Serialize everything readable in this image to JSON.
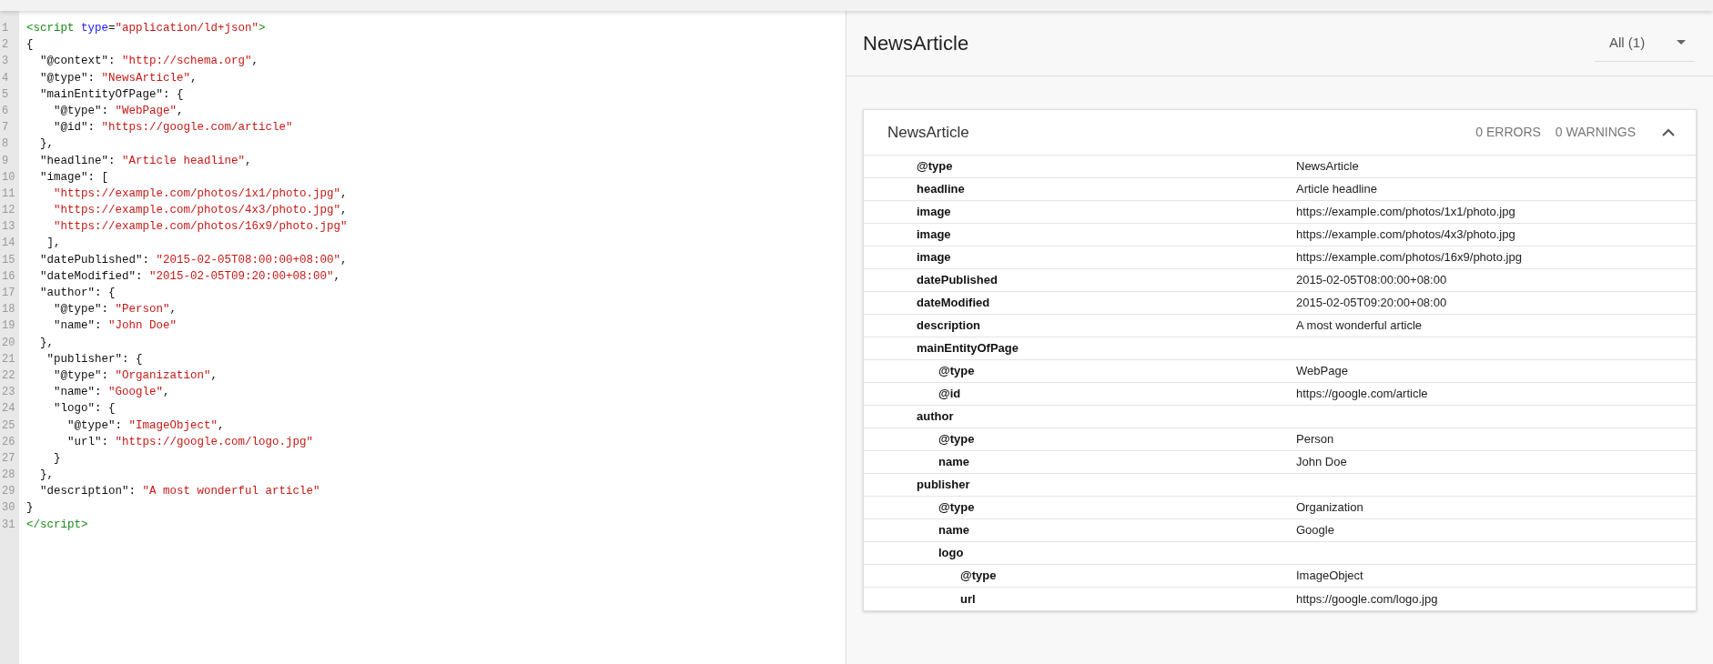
{
  "code": {
    "lines": [
      {
        "number": "1",
        "tokens": [
          {
            "kind": "tag",
            "text": "<script"
          },
          {
            "kind": "attr",
            "text": " type"
          },
          {
            "kind": "plain",
            "text": "="
          },
          {
            "kind": "string",
            "text": "\"application/ld+json\""
          },
          {
            "kind": "tag",
            "text": ">"
          }
        ]
      },
      {
        "number": "2",
        "tokens": [
          {
            "kind": "plain",
            "text": "{"
          }
        ]
      },
      {
        "number": "3",
        "tokens": [
          {
            "kind": "plain",
            "text": "  \"@context\": "
          },
          {
            "kind": "string",
            "text": "\"http://schema.org\""
          },
          {
            "kind": "plain",
            "text": ","
          }
        ]
      },
      {
        "number": "4",
        "tokens": [
          {
            "kind": "plain",
            "text": "  \"@type\": "
          },
          {
            "kind": "string",
            "text": "\"NewsArticle\""
          },
          {
            "kind": "plain",
            "text": ","
          }
        ]
      },
      {
        "number": "5",
        "tokens": [
          {
            "kind": "plain",
            "text": "  \"mainEntityOfPage\": {"
          }
        ]
      },
      {
        "number": "6",
        "tokens": [
          {
            "kind": "plain",
            "text": "    \"@type\": "
          },
          {
            "kind": "string",
            "text": "\"WebPage\""
          },
          {
            "kind": "plain",
            "text": ","
          }
        ]
      },
      {
        "number": "7",
        "tokens": [
          {
            "kind": "plain",
            "text": "    \"@id\": "
          },
          {
            "kind": "string",
            "text": "\"https://google.com/article\""
          }
        ]
      },
      {
        "number": "8",
        "tokens": [
          {
            "kind": "plain",
            "text": "  },"
          }
        ]
      },
      {
        "number": "9",
        "tokens": [
          {
            "kind": "plain",
            "text": "  \"headline\": "
          },
          {
            "kind": "string",
            "text": "\"Article headline\""
          },
          {
            "kind": "plain",
            "text": ","
          }
        ]
      },
      {
        "number": "10",
        "tokens": [
          {
            "kind": "plain",
            "text": "  \"image\": ["
          }
        ]
      },
      {
        "number": "11",
        "tokens": [
          {
            "kind": "string",
            "text": "    \"https://example.com/photos/1x1/photo.jpg\""
          },
          {
            "kind": "plain",
            "text": ","
          }
        ]
      },
      {
        "number": "12",
        "tokens": [
          {
            "kind": "string",
            "text": "    \"https://example.com/photos/4x3/photo.jpg\""
          },
          {
            "kind": "plain",
            "text": ","
          }
        ]
      },
      {
        "number": "13",
        "tokens": [
          {
            "kind": "string",
            "text": "    \"https://example.com/photos/16x9/photo.jpg\""
          }
        ]
      },
      {
        "number": "14",
        "tokens": [
          {
            "kind": "plain",
            "text": "   ],"
          }
        ]
      },
      {
        "number": "15",
        "tokens": [
          {
            "kind": "plain",
            "text": "  \"datePublished\": "
          },
          {
            "kind": "string",
            "text": "\"2015-02-05T08:00:00+08:00\""
          },
          {
            "kind": "plain",
            "text": ","
          }
        ]
      },
      {
        "number": "16",
        "tokens": [
          {
            "kind": "plain",
            "text": "  \"dateModified\": "
          },
          {
            "kind": "string",
            "text": "\"2015-02-05T09:20:00+08:00\""
          },
          {
            "kind": "plain",
            "text": ","
          }
        ]
      },
      {
        "number": "17",
        "tokens": [
          {
            "kind": "plain",
            "text": "  \"author\": {"
          }
        ]
      },
      {
        "number": "18",
        "tokens": [
          {
            "kind": "plain",
            "text": "    \"@type\": "
          },
          {
            "kind": "string",
            "text": "\"Person\""
          },
          {
            "kind": "plain",
            "text": ","
          }
        ]
      },
      {
        "number": "19",
        "tokens": [
          {
            "kind": "plain",
            "text": "    \"name\": "
          },
          {
            "kind": "string",
            "text": "\"John Doe\""
          }
        ]
      },
      {
        "number": "20",
        "tokens": [
          {
            "kind": "plain",
            "text": "  },"
          }
        ]
      },
      {
        "number": "21",
        "tokens": [
          {
            "kind": "plain",
            "text": "   \"publisher\": {"
          }
        ]
      },
      {
        "number": "22",
        "tokens": [
          {
            "kind": "plain",
            "text": "    \"@type\": "
          },
          {
            "kind": "string",
            "text": "\"Organization\""
          },
          {
            "kind": "plain",
            "text": ","
          }
        ]
      },
      {
        "number": "23",
        "tokens": [
          {
            "kind": "plain",
            "text": "    \"name\": "
          },
          {
            "kind": "string",
            "text": "\"Google\""
          },
          {
            "kind": "plain",
            "text": ","
          }
        ]
      },
      {
        "number": "24",
        "tokens": [
          {
            "kind": "plain",
            "text": "    \"logo\": {"
          }
        ]
      },
      {
        "number": "25",
        "tokens": [
          {
            "kind": "plain",
            "text": "      \"@type\": "
          },
          {
            "kind": "string",
            "text": "\"ImageObject\""
          },
          {
            "kind": "plain",
            "text": ","
          }
        ]
      },
      {
        "number": "26",
        "tokens": [
          {
            "kind": "plain",
            "text": "      \"url\": "
          },
          {
            "kind": "string",
            "text": "\"https://google.com/logo.jpg\""
          }
        ]
      },
      {
        "number": "27",
        "tokens": [
          {
            "kind": "plain",
            "text": "    }"
          }
        ]
      },
      {
        "number": "28",
        "tokens": [
          {
            "kind": "plain",
            "text": "  },"
          }
        ]
      },
      {
        "number": "29",
        "tokens": [
          {
            "kind": "plain",
            "text": "  \"description\": "
          },
          {
            "kind": "string",
            "text": "\"A most wonderful article\""
          }
        ]
      },
      {
        "number": "30",
        "tokens": [
          {
            "kind": "plain",
            "text": "}"
          }
        ]
      },
      {
        "number": "31",
        "tokens": [
          {
            "kind": "tag",
            "text": "</script>"
          }
        ]
      }
    ]
  },
  "results": {
    "title": "NewsArticle",
    "filter": "All (1)",
    "card": {
      "title": "NewsArticle",
      "errors": "0 ERRORS",
      "warnings": "0 WARNINGS",
      "expanded": true,
      "rows": [
        {
          "key": "@type",
          "value": "NewsArticle"
        },
        {
          "key": "headline",
          "value": "Article headline"
        },
        {
          "key": "image",
          "value": "https://example.com/photos/1x1/photo.jpg"
        },
        {
          "key": "image",
          "value": "https://example.com/photos/4x3/photo.jpg"
        },
        {
          "key": "image",
          "value": "https://example.com/photos/16x9/photo.jpg"
        },
        {
          "key": "datePublished",
          "value": "2015-02-05T08:00:00+08:00"
        },
        {
          "key": "dateModified",
          "value": "2015-02-05T09:20:00+08:00"
        },
        {
          "key": "description",
          "value": "A most wonderful article"
        },
        {
          "key": "mainEntityOfPage",
          "children": [
            {
              "key": "@type",
              "value": "WebPage"
            },
            {
              "key": "@id",
              "value": "https://google.com/article"
            }
          ]
        },
        {
          "key": "author",
          "children": [
            {
              "key": "@type",
              "value": "Person"
            },
            {
              "key": "name",
              "value": "John Doe"
            }
          ]
        },
        {
          "key": "publisher",
          "children": [
            {
              "key": "@type",
              "value": "Organization"
            },
            {
              "key": "name",
              "value": "Google"
            },
            {
              "key": "logo",
              "children": [
                {
                  "key": "@type",
                  "value": "ImageObject"
                },
                {
                  "key": "url",
                  "value": "https://google.com/logo.jpg"
                }
              ]
            }
          ]
        }
      ]
    }
  }
}
